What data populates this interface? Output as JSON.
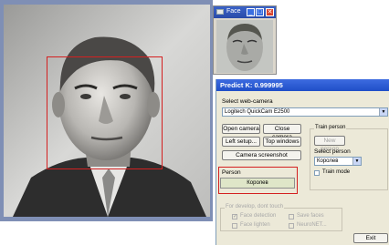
{
  "face_window": {
    "title": "Face",
    "minimize_glyph": "_",
    "maximize_glyph": "□",
    "close_glyph": "✕"
  },
  "dialog": {
    "title": "Predict K: 0.999995",
    "select_webcam_label": "Select web-camera",
    "webcam_value": "Logitech QuickCam E2500",
    "open_camera": "Open camera",
    "close_camera": "Close camera",
    "left_setup": "Left setup...",
    "top_windows": "Top windows",
    "camera_screenshot": "Camera screenshot",
    "train_group_label": "Train person",
    "new_person": "New person",
    "select_person_label": "Select person",
    "selected_person": "Королев",
    "train_mode": "Train mode",
    "person_label": "Person",
    "person_value": "Королев",
    "dev_group_label": "For develop, dont touch",
    "face_detection": "Face detection",
    "face_lighten": "Face lighten",
    "save_faces": "Save faces",
    "neuronet": "NeuroNET...",
    "exit": "Exit",
    "dropdown_arrow": "▼"
  }
}
